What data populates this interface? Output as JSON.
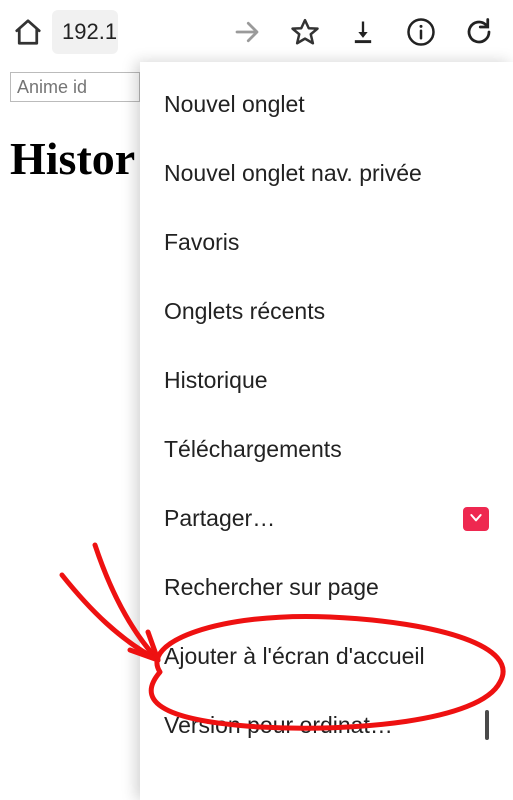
{
  "toolbar": {
    "url": "192.1"
  },
  "page": {
    "input_placeholder": "Anime id",
    "heading": "Histor"
  },
  "menu": {
    "items": [
      {
        "label": "Nouvel onglet"
      },
      {
        "label": "Nouvel onglet nav. privée"
      },
      {
        "label": "Favoris"
      },
      {
        "label": "Onglets récents"
      },
      {
        "label": "Historique"
      },
      {
        "label": "Téléchargements"
      },
      {
        "label": "Partager…",
        "right": "pocket"
      },
      {
        "label": "Rechercher sur page"
      },
      {
        "label": "Ajouter à l'écran d'accueil"
      },
      {
        "label": "Version pour ordinat…",
        "right": "checkbox"
      }
    ]
  }
}
